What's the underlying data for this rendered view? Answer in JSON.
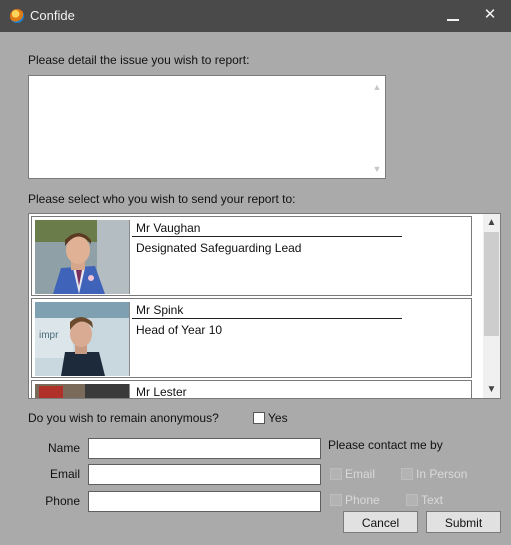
{
  "window": {
    "title": "Confide",
    "minimize_symbol": "–",
    "close_symbol": "✕"
  },
  "issue": {
    "label": "Please detail the issue you wish to report:",
    "value": ""
  },
  "recipients": {
    "label": "Please select who you wish to send your report to:",
    "items": [
      {
        "name": "Mr Vaughan",
        "role": "Designated Safeguarding Lead"
      },
      {
        "name": "Mr Spink",
        "role": "Head of Year 10"
      },
      {
        "name": "Mr Lester",
        "role": ""
      }
    ]
  },
  "anonymous": {
    "question": "Do you wish to remain anonymous?",
    "option": "Yes",
    "checked": false
  },
  "form": {
    "name_label": "Name",
    "email_label": "Email",
    "phone_label": "Phone",
    "name_value": "",
    "email_value": "",
    "phone_value": ""
  },
  "contact": {
    "label": "Please contact me by",
    "options": [
      {
        "label": "Email",
        "enabled": false
      },
      {
        "label": "In Person",
        "enabled": false
      },
      {
        "label": "Phone",
        "enabled": false
      },
      {
        "label": "Text",
        "enabled": false
      }
    ]
  },
  "buttons": {
    "cancel": "Cancel",
    "submit": "Submit"
  },
  "icons": {
    "app": "confide-logo-icon",
    "minimize": "minimize-icon",
    "close": "close-icon",
    "scroll_up": "chevron-up-icon",
    "scroll_down": "chevron-down-icon"
  }
}
